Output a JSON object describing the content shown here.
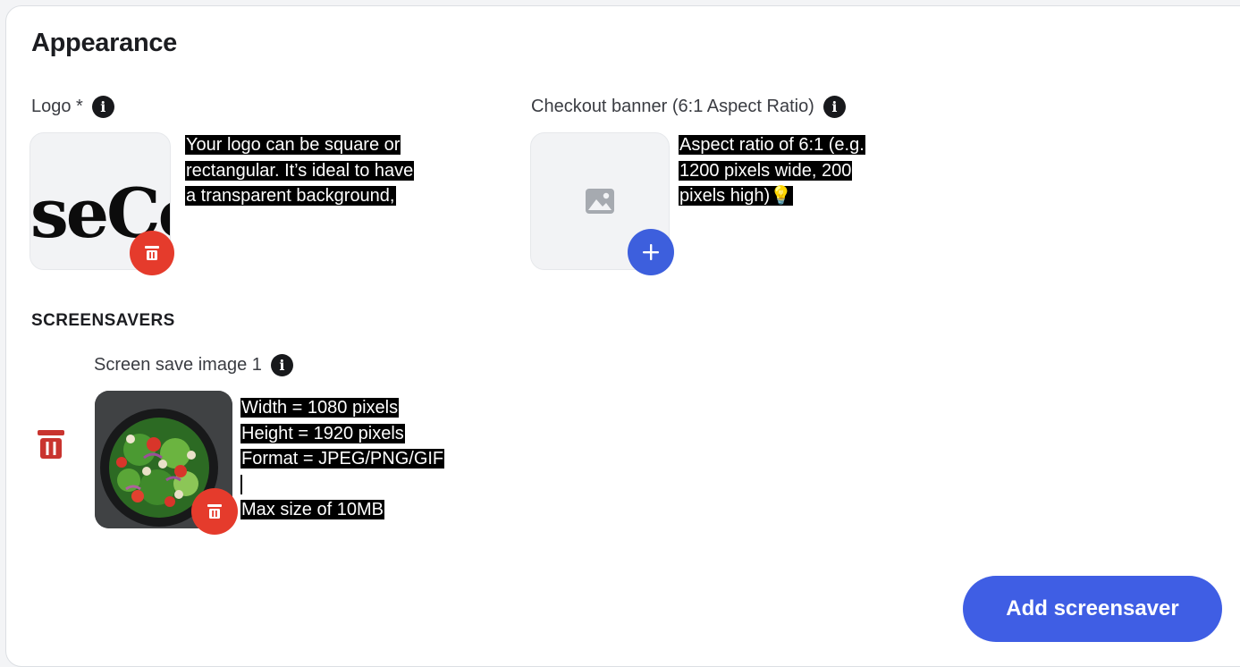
{
  "section": {
    "title": "Appearance"
  },
  "logo": {
    "label": "Logo *",
    "preview_text": "seCo",
    "tooltip": [
      "Your logo can be square or",
      "rectangular. It’s ideal to have",
      "a transparent background,"
    ],
    "delete_icon": "trash-icon"
  },
  "banner": {
    "label": "Checkout banner (6:1 Aspect Ratio)",
    "tooltip": [
      "Aspect ratio of 6:1 (e.g.",
      "1200 pixels wide, 200",
      "pixels high)💡"
    ],
    "placeholder_icon": "image-icon",
    "add_icon": "plus-icon"
  },
  "screensavers": {
    "heading": "SCREENSAVERS",
    "items": [
      {
        "label": "Screen save image 1",
        "tooltip": [
          "Width  = 1080 pixels",
          "Height = 1920 pixels",
          "Format = JPEG/PNG/GIF",
          "",
          "Max size of 10MB"
        ]
      }
    ],
    "add_button_label": "Add screensaver"
  },
  "colors": {
    "primary_blue": "#3f5ee4",
    "danger_red": "#e53b2c",
    "delete_red": "#c9342f"
  }
}
